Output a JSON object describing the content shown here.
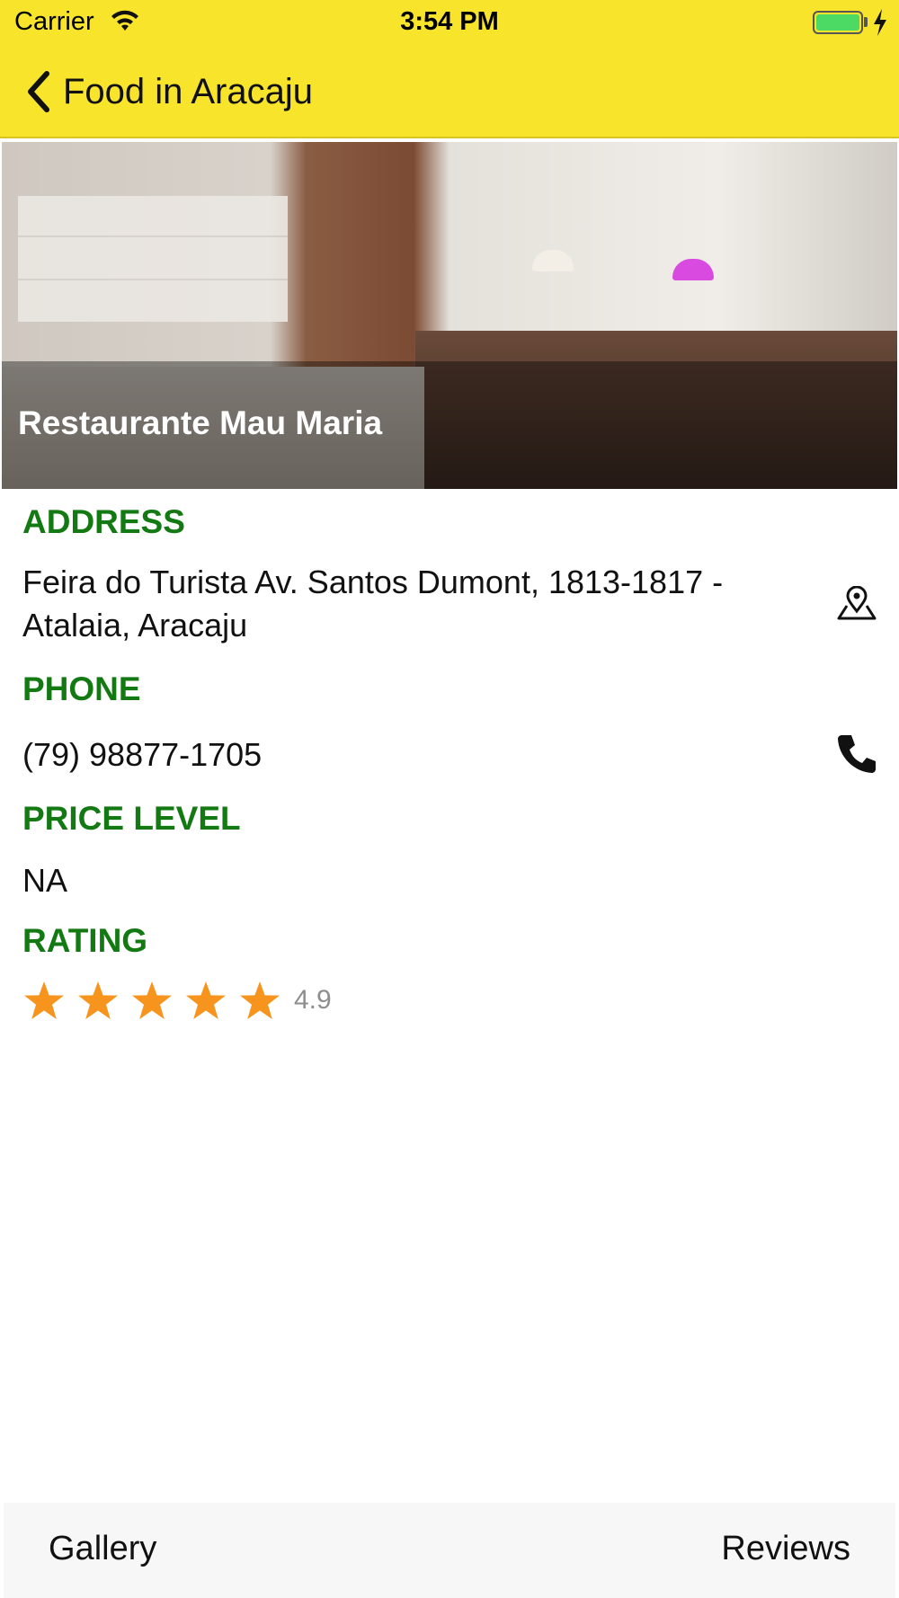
{
  "status_bar": {
    "carrier": "Carrier",
    "time": "3:54 PM",
    "battery_level": 1.0
  },
  "nav": {
    "back_label": "Food in Aracaju",
    "back_icon": "chevron-left-icon"
  },
  "hero": {
    "title": "Restaurante Mau Maria"
  },
  "details": {
    "address_label": "ADDRESS",
    "address_line1": "Feira do Turista Av. Santos Dumont, 1813-1817 -",
    "address_line2": "Atalaia, Aracaju",
    "address_icon": "map-pin-icon",
    "phone_label": "PHONE",
    "phone": "(79) 98877-1705",
    "phone_icon": "phone-icon",
    "price_label": "PRICE LEVEL",
    "price": "NA",
    "rating_label": "RATING",
    "rating_stars": 5,
    "rating_value": "4.9"
  },
  "tabs": {
    "gallery": "Gallery",
    "reviews": "Reviews"
  },
  "colors": {
    "nav_bg": "#f8e42a",
    "label_green": "#137a13",
    "star_orange": "#f7941d"
  }
}
